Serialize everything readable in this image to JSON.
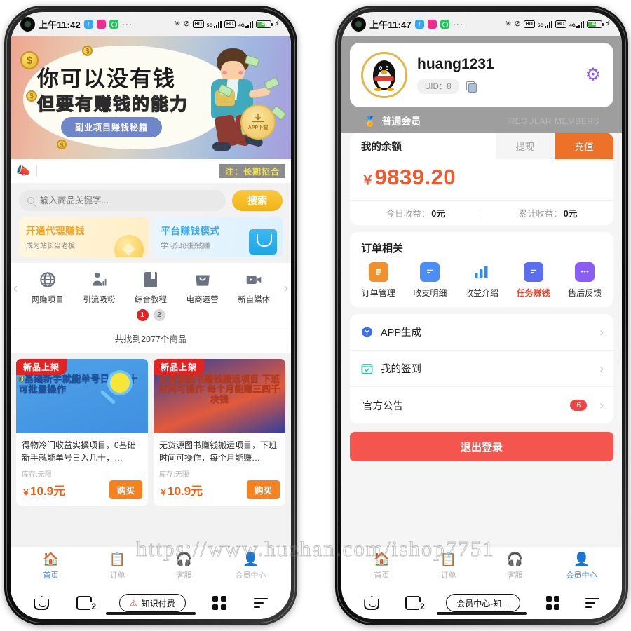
{
  "left_phone": {
    "status_bar": {
      "time": "上午11:42",
      "app_icons": [
        "blue-arrow-icon",
        "pink-app-icon",
        "green-app-icon"
      ],
      "overflow": "···",
      "bluetooth": "✳",
      "mute": "🔇",
      "hd1": "HD",
      "net1": "5G",
      "hd2": "HD",
      "net2": "4G",
      "battery": "45",
      "charging": "⚡"
    },
    "banner": {
      "title_line1": "你可以没有钱",
      "title_line2": "但要有赚钱的能力",
      "pill": "副业项目赚钱秘籍"
    },
    "notice": {
      "tag": "注：长期招合"
    },
    "search": {
      "placeholder": "输入商品关键字...",
      "button": "搜索"
    },
    "promos": [
      {
        "title": "开通代理赚钱",
        "subtitle": "成为站长当老板",
        "icon": "coin-icon"
      },
      {
        "title": "平台赚钱模式",
        "subtitle": "学习知识把钱赚",
        "icon": "bag-icon"
      }
    ],
    "categories": [
      {
        "label": "网赚项目",
        "icon": "globe-icon"
      },
      {
        "label": "引流吸粉",
        "icon": "person-chart-icon"
      },
      {
        "label": "综合教程",
        "icon": "book-icon"
      },
      {
        "label": "电商运营",
        "icon": "shopping-bag-icon"
      },
      {
        "label": "新自媒体",
        "icon": "video-camera-icon"
      }
    ],
    "pager": {
      "current": "1",
      "next": "2"
    },
    "found_text": "共找到2077个商品",
    "products": [
      {
        "badge": "新品上架",
        "image_text": "0基础新手就能单号日入几十 可批量操作",
        "name": "得物冷门收益实操项目，0基础新手就能单号日入几十，…",
        "stock": "库存:无限",
        "currency": "￥",
        "price": "10.9元",
        "buy": "购买"
      },
      {
        "badge": "新品上架",
        "image_text": "无货源图书赚钱搬运项目 下班时间可操作 每个月能赚三四千块钱",
        "name": "无货源图书赚钱搬运项目，下班时间可操作，每个月能赚…",
        "stock": "库存:无限",
        "currency": "￥",
        "price": "10.9元",
        "buy": "购买"
      }
    ],
    "app_download_badge": "APP下载",
    "tabbar": [
      {
        "label": "首页",
        "icon": "home-icon",
        "active": true
      },
      {
        "label": "订单",
        "icon": "order-list-icon",
        "active": false
      },
      {
        "label": "客服",
        "icon": "headset-icon",
        "active": false
      },
      {
        "label": "会员中心",
        "icon": "user-icon",
        "active": false
      }
    ],
    "browser_nav": {
      "home": "home-icon",
      "tabs_count": "2",
      "url_label": "知识付费",
      "url_warn_icon": "warning-icon",
      "grid": "grid-icon",
      "menu": "menu-icon"
    }
  },
  "right_phone": {
    "status_bar": {
      "time": "上午11:47",
      "app_icons": [
        "blue-arrow-icon",
        "pink-app-icon",
        "green-app-icon"
      ],
      "overflow": "···",
      "battery": "47"
    },
    "profile": {
      "username": "huang1231",
      "uid": "UID：8",
      "avatar": "qq-penguin-avatar",
      "copy_icon": "copy-icon",
      "settings_icon": "gear-icon"
    },
    "membership": {
      "medal": "🏅",
      "label_cn": "普通会员",
      "label_en": "REGULAR MEMBERS"
    },
    "balance": {
      "title": "我的余额",
      "withdraw": "提现",
      "recharge": "充值",
      "currency": "￥",
      "amount": "9839.20",
      "today_label": "今日收益：",
      "today_value": "0元",
      "total_label": "累计收益：",
      "total_value": "0元"
    },
    "orders": {
      "title": "订单相关",
      "items": [
        {
          "label": "订单管理",
          "icon": "clipboard-icon",
          "color": "#f0912f"
        },
        {
          "label": "收支明细",
          "icon": "receipt-icon",
          "color": "#4d8df6"
        },
        {
          "label": "收益介绍",
          "icon": "bar-chart-icon",
          "color": "#2f8ce8"
        },
        {
          "label": "任务赚钱",
          "icon": "receipt-blue-icon",
          "color": "#5b6ef0",
          "highlight": true
        },
        {
          "label": "售后反馈",
          "icon": "chat-icon",
          "color": "#8b5cf6"
        }
      ]
    },
    "menu": [
      {
        "label": "APP生成",
        "icon": "cube-icon",
        "badge": ""
      },
      {
        "label": "我的签到",
        "icon": "calendar-check-icon",
        "badge": ""
      },
      {
        "label": "官方公告",
        "icon": "",
        "badge": "6"
      }
    ],
    "logout": "退出登录",
    "tabbar": [
      {
        "label": "首页",
        "icon": "home-icon",
        "active": false
      },
      {
        "label": "订单",
        "icon": "order-list-icon",
        "active": false
      },
      {
        "label": "客服",
        "icon": "headset-icon",
        "active": false
      },
      {
        "label": "会员中心",
        "icon": "user-icon",
        "active": true
      }
    ],
    "browser_nav": {
      "tabs_count": "2",
      "url_label": "会员中心-知…"
    }
  },
  "watermark": "https://www.huzhan.com/ishop7751"
}
